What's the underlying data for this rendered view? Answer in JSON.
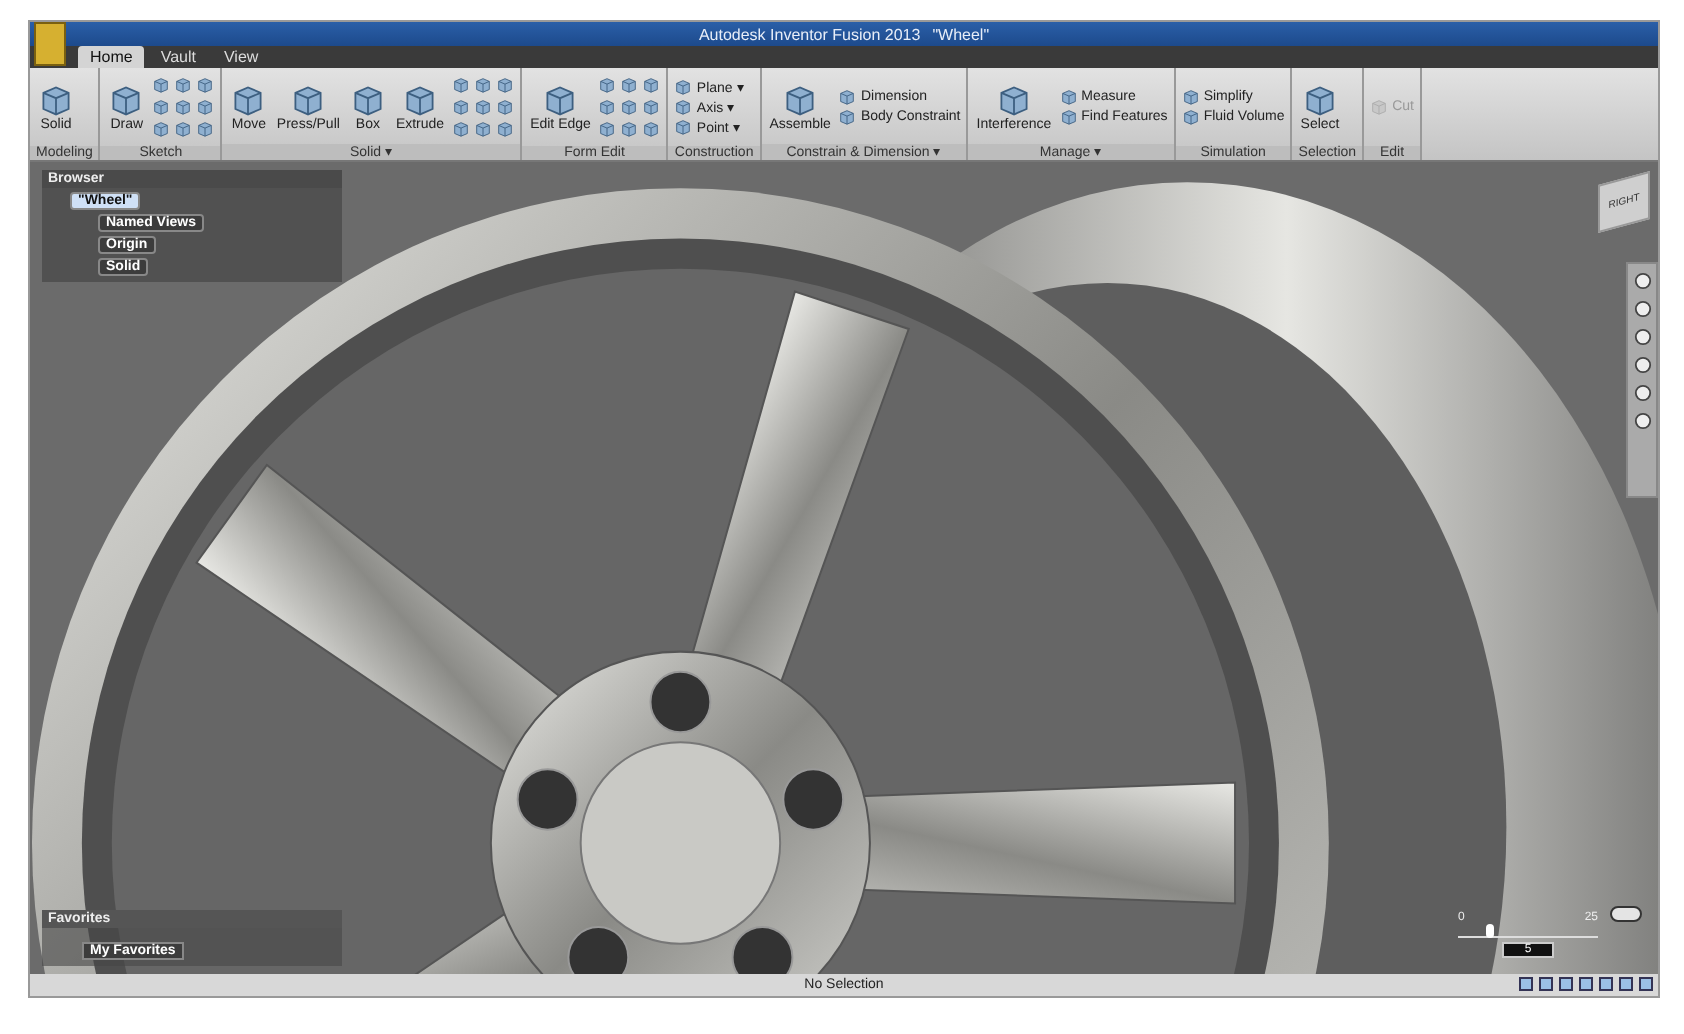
{
  "window": {
    "title": "Autodesk Inventor Fusion 2013",
    "document": "\"Wheel\""
  },
  "tabs": [
    {
      "label": "Home",
      "selected": true
    },
    {
      "label": "Vault",
      "selected": false
    },
    {
      "label": "View",
      "selected": false
    }
  ],
  "ribbon": [
    {
      "title": "Modeling",
      "tools": [
        {
          "kind": "large",
          "label": "Solid",
          "disabled": false
        }
      ]
    },
    {
      "title": "Sketch",
      "tools": [
        {
          "kind": "large",
          "label": "Draw",
          "disabled": false
        },
        {
          "kind": "grid"
        }
      ]
    },
    {
      "title": "Solid ▾",
      "tools": [
        {
          "kind": "large",
          "label": "Move",
          "disabled": false
        },
        {
          "kind": "large",
          "label": "Press/Pull",
          "disabled": false
        },
        {
          "kind": "large",
          "label": "Box",
          "disabled": false
        },
        {
          "kind": "large",
          "label": "Extrude",
          "disabled": false
        },
        {
          "kind": "grid"
        }
      ]
    },
    {
      "title": "Form Edit",
      "tools": [
        {
          "kind": "large",
          "label": "Edit Edge",
          "disabled": false
        },
        {
          "kind": "grid"
        }
      ]
    },
    {
      "title": "Construction",
      "tools": [
        {
          "kind": "small",
          "label": "Plane ▾",
          "disabled": false
        },
        {
          "kind": "small",
          "label": "Axis ▾",
          "disabled": false
        },
        {
          "kind": "small",
          "label": "Point ▾",
          "disabled": false
        }
      ]
    },
    {
      "title": "Constrain & Dimension ▾",
      "tools": [
        {
          "kind": "large",
          "label": "Assemble",
          "disabled": false
        },
        {
          "kind": "small",
          "label": "Dimension",
          "disabled": false
        },
        {
          "kind": "small",
          "label": "Body Constraint",
          "disabled": false
        }
      ]
    },
    {
      "title": "Manage ▾",
      "tools": [
        {
          "kind": "large",
          "label": "Interference",
          "disabled": false
        },
        {
          "kind": "small",
          "label": "Measure",
          "disabled": false
        },
        {
          "kind": "small",
          "label": "Find Features",
          "disabled": false
        }
      ]
    },
    {
      "title": "Simulation",
      "tools": [
        {
          "kind": "small",
          "label": "Simplify",
          "disabled": false
        },
        {
          "kind": "small",
          "label": "Fluid Volume",
          "disabled": false
        }
      ]
    },
    {
      "title": "Selection",
      "tools": [
        {
          "kind": "large",
          "label": "Select",
          "disabled": false
        }
      ]
    },
    {
      "title": "Edit",
      "tools": [
        {
          "kind": "small",
          "label": "Cut",
          "disabled": true
        }
      ]
    }
  ],
  "browser": {
    "title": "Browser",
    "tree": [
      {
        "label": "\"Wheel\"",
        "selected": true,
        "children": [
          {
            "label": "Named Views",
            "selected": false
          },
          {
            "label": "Origin",
            "selected": false
          },
          {
            "label": "Solid",
            "selected": false
          }
        ]
      }
    ]
  },
  "favorites": {
    "title": "Favorites",
    "items": [
      {
        "label": "My Favorites"
      }
    ]
  },
  "viewcube": {
    "label": "RIGHT"
  },
  "timeline": {
    "start": "0",
    "end": "25",
    "value": "5",
    "level": 0.2
  },
  "status_bar": {
    "text": "No Selection"
  }
}
